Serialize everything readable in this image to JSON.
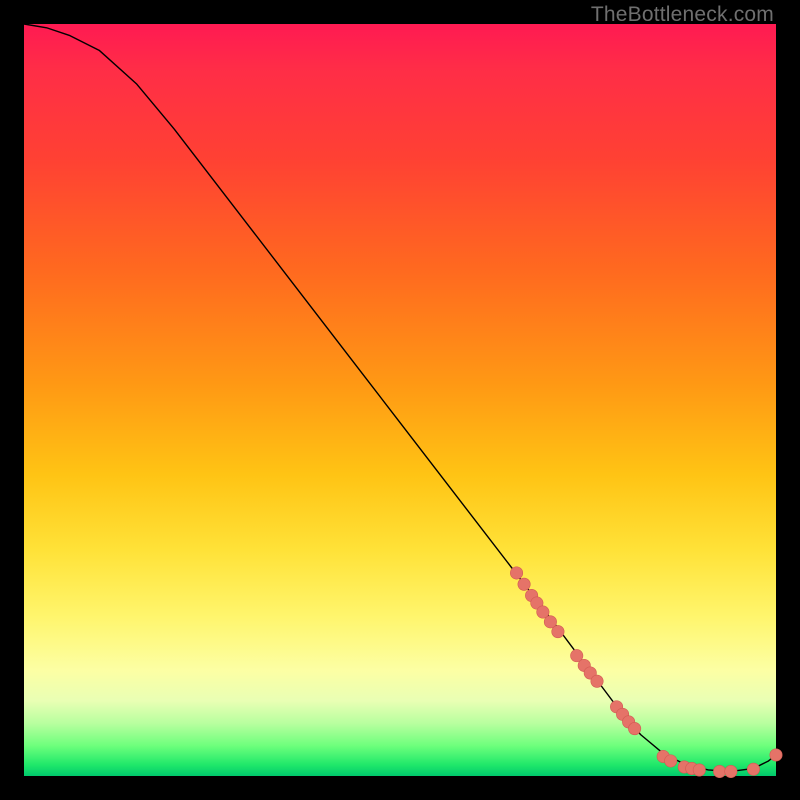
{
  "watermark": "TheBottleneck.com",
  "colors": {
    "curve_stroke": "#000000",
    "marker_fill": "#e57368",
    "marker_stroke": "#d25a52",
    "gradient_top": "#ff1a52",
    "gradient_bottom": "#00c96c"
  },
  "chart_data": {
    "type": "line",
    "title": "",
    "xlabel": "",
    "ylabel": "",
    "xlim": [
      0,
      100
    ],
    "ylim": [
      0,
      100
    ],
    "grid": false,
    "legend": false,
    "annotations": [],
    "series": [
      {
        "name": "curve",
        "x": [
          0,
          3,
          6,
          10,
          15,
          20,
          25,
          30,
          35,
          40,
          45,
          50,
          55,
          60,
          65,
          70,
          73,
          76,
          79,
          82,
          85,
          88,
          91,
          94,
          97,
          99,
          100
        ],
        "y": [
          100,
          99.5,
          98.5,
          96.5,
          92,
          86,
          79.5,
          73,
          66.5,
          60,
          53.5,
          47,
          40.5,
          34,
          27.5,
          21,
          17,
          13,
          9,
          5.5,
          3,
          1.5,
          0.8,
          0.6,
          1,
          2,
          2.8
        ]
      }
    ],
    "markers": [
      {
        "x": 65.5,
        "y": 27.0
      },
      {
        "x": 66.5,
        "y": 25.5
      },
      {
        "x": 67.5,
        "y": 24.0
      },
      {
        "x": 68.2,
        "y": 23.0
      },
      {
        "x": 69.0,
        "y": 21.8
      },
      {
        "x": 70.0,
        "y": 20.5
      },
      {
        "x": 71.0,
        "y": 19.2
      },
      {
        "x": 73.5,
        "y": 16.0
      },
      {
        "x": 74.5,
        "y": 14.7
      },
      {
        "x": 75.3,
        "y": 13.7
      },
      {
        "x": 76.2,
        "y": 12.6
      },
      {
        "x": 78.8,
        "y": 9.2
      },
      {
        "x": 79.6,
        "y": 8.2
      },
      {
        "x": 80.4,
        "y": 7.2
      },
      {
        "x": 81.2,
        "y": 6.3
      },
      {
        "x": 85.0,
        "y": 2.6
      },
      {
        "x": 86.0,
        "y": 2.0
      },
      {
        "x": 87.8,
        "y": 1.2
      },
      {
        "x": 88.8,
        "y": 1.0
      },
      {
        "x": 89.8,
        "y": 0.8
      },
      {
        "x": 92.5,
        "y": 0.6
      },
      {
        "x": 94.0,
        "y": 0.6
      },
      {
        "x": 97.0,
        "y": 0.9
      },
      {
        "x": 100.0,
        "y": 2.8
      }
    ]
  }
}
